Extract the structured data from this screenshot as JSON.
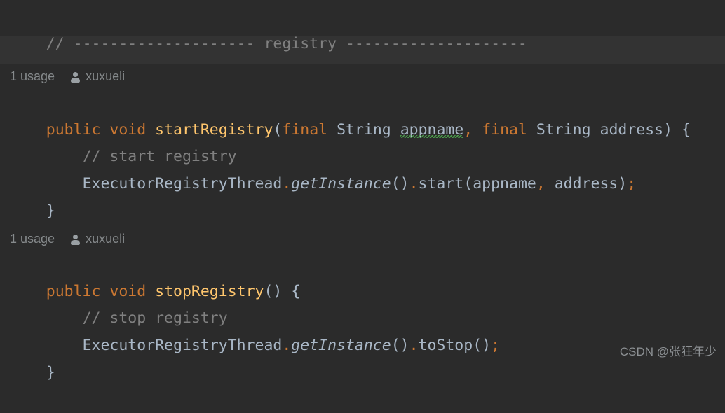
{
  "editor": {
    "background": "#2b2b2b",
    "highlight_band_color": "#333333",
    "colors": {
      "keyword": "#cc7832",
      "method_declaration": "#ffc66d",
      "identifier": "#a9b7c6",
      "comment": "#808080",
      "hint": "#868a8c",
      "typo_underline": "#4a9a4a"
    }
  },
  "code": {
    "section_comment": {
      "slashes": "// ",
      "dashes_left": "--------------------",
      "title": " registry ",
      "dashes_right": "--------------------"
    },
    "method_1": {
      "hint": {
        "usage": "1 usage",
        "author": "xuxueli",
        "icon": "person-icon"
      },
      "signature": {
        "modifier": "public",
        "return_type": "void",
        "name": "startRegistry",
        "open_paren": "(",
        "param_1_final": "final",
        "param_1_type": "String",
        "param_1_name": "appname",
        "comma": ",",
        "param_2_final": "final",
        "param_2_type": "String",
        "param_2_name": "address",
        "close_paren": ")",
        "open_brace": "{"
      },
      "body_comment": "// start registry",
      "body_statement": {
        "class_name": "ExecutorRegistryThread",
        "dot_1": ".",
        "static_method": "getInstance",
        "call_parens": "()",
        "dot_2": ".",
        "method": "start",
        "open_paren": "(",
        "arg_1": "appname",
        "comma": ",",
        "arg_2": "address",
        "close_paren": ")",
        "semicolon": ";"
      },
      "close_brace": "}"
    },
    "method_2": {
      "hint": {
        "usage": "1 usage",
        "author": "xuxueli",
        "icon": "person-icon"
      },
      "signature": {
        "modifier": "public",
        "return_type": "void",
        "name": "stopRegistry",
        "parens": "()",
        "open_brace": "{"
      },
      "body_comment": "// stop registry",
      "body_statement": {
        "class_name": "ExecutorRegistryThread",
        "dot_1": ".",
        "static_method": "getInstance",
        "call_parens": "()",
        "dot_2": ".",
        "method": "toStop",
        "call_parens_2": "()",
        "semicolon": ";"
      },
      "close_brace": "}"
    }
  },
  "watermark": {
    "text": "CSDN @张狂年少"
  }
}
